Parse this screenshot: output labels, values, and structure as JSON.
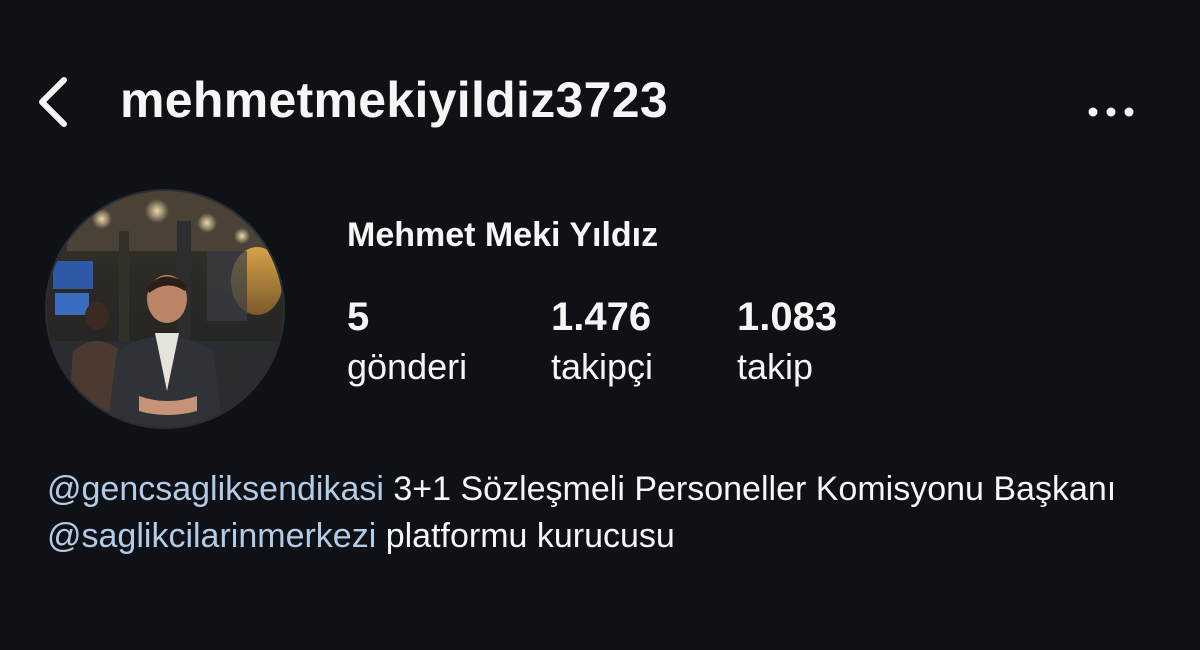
{
  "header": {
    "username": "mehmetmekiyildiz3723",
    "back_icon": "chevron-left-icon",
    "more_icon": "more-horizontal-icon"
  },
  "profile": {
    "full_name": "Mehmet Meki Yıldız",
    "avatar_icon": "profile-photo"
  },
  "stats": {
    "posts": {
      "value": "5",
      "label": "gönderi"
    },
    "followers": {
      "value": "1.476",
      "label": "takipçi"
    },
    "following": {
      "value": "1.083",
      "label": "takip"
    }
  },
  "bio": {
    "line1_mention": "@gencsagliksendikasi",
    "line1_text": " 3+1 Sözleşmeli Personeller Komisyonu Başkanı",
    "line2_mention": "@saglikcilarinmerkezi",
    "line2_text": " platformu kurucusu"
  },
  "colors": {
    "background": "#0e1115",
    "text": "#f5f6f7",
    "mention": "#b4cbe6"
  }
}
